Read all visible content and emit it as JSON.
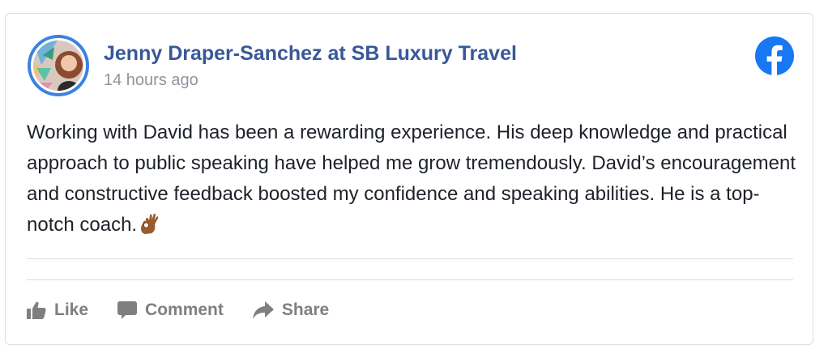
{
  "post": {
    "author": "Jenny Draper-Sanchez at SB Luxury Travel",
    "timestamp": "14 hours ago",
    "text": "Working with David has been a rewarding experience. His deep knowledge and practical approach to public speaking have helped me grow tremendously. David’s encouragement and constructive feedback boosted my confidence and speaking abilities. He is a top-notch coach.",
    "emoji": "ok-hand-emoji"
  },
  "actions": {
    "like_label": "Like",
    "comment_label": "Comment",
    "share_label": "Share"
  },
  "icons": {
    "platform": "facebook-icon",
    "like": "thumbs-up-icon",
    "comment": "speech-bubble-icon",
    "share": "share-arrow-icon"
  },
  "colors": {
    "author_link": "#385898",
    "facebook_blue": "#1877F2",
    "action_gray": "#7f7f7f",
    "timestamp_gray": "#90949c",
    "text": "#1d2129"
  }
}
